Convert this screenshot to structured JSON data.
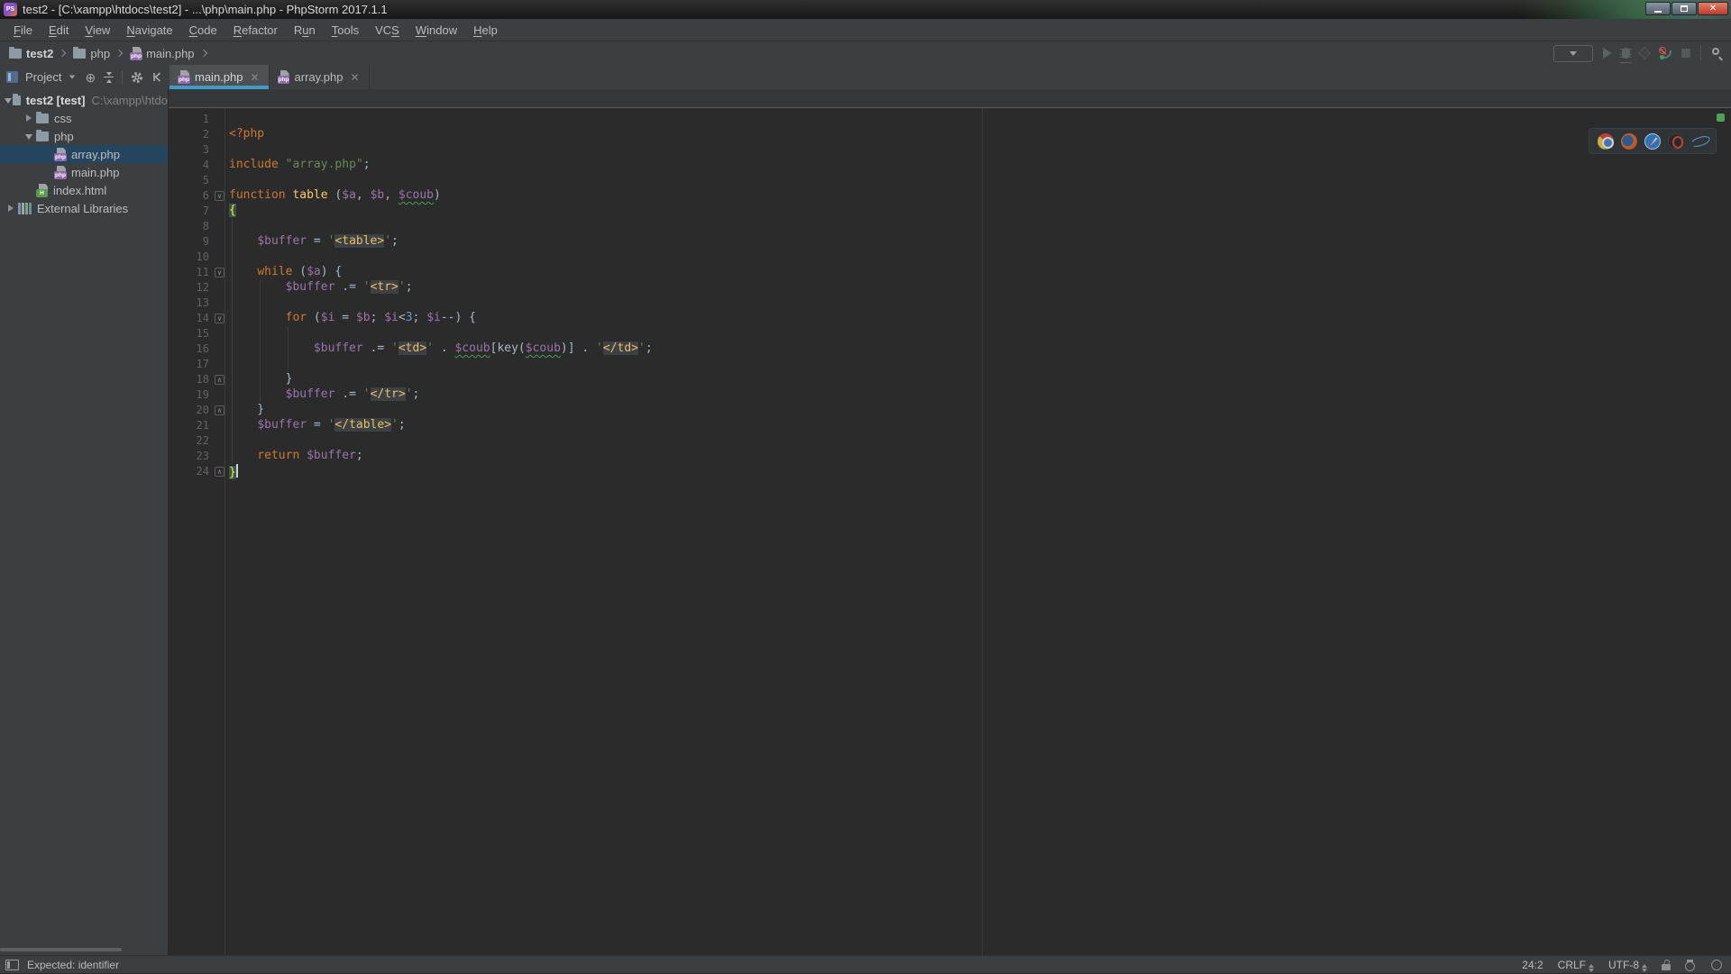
{
  "window": {
    "title": "test2 - [C:\\xampp\\htdocs\\test2] - ...\\php\\main.php - PhpStorm 2017.1.1",
    "app_badge": "PS"
  },
  "menu": {
    "items": [
      {
        "label": "File",
        "mnemonic": 0
      },
      {
        "label": "Edit",
        "mnemonic": 0
      },
      {
        "label": "View",
        "mnemonic": 0
      },
      {
        "label": "Navigate",
        "mnemonic": 0
      },
      {
        "label": "Code",
        "mnemonic": 0
      },
      {
        "label": "Refactor",
        "mnemonic": 0
      },
      {
        "label": "Run",
        "mnemonic": 1
      },
      {
        "label": "Tools",
        "mnemonic": 0
      },
      {
        "label": "VCS",
        "mnemonic": 2
      },
      {
        "label": "Window",
        "mnemonic": 0
      },
      {
        "label": "Help",
        "mnemonic": 0
      }
    ]
  },
  "breadcrumbs": {
    "items": [
      {
        "label": "test2",
        "icon": "folder",
        "bold": true
      },
      {
        "label": "php",
        "icon": "folder",
        "bold": false
      },
      {
        "label": "main.php",
        "icon": "php-file",
        "bold": false
      }
    ]
  },
  "project_panel": {
    "header_label": "Project",
    "tree": [
      {
        "label": "test2 [test]",
        "hint": "C:\\xampp\\htdo",
        "icon": "folder",
        "depth": 0,
        "arrow": "expanded",
        "bold": true,
        "selected": false
      },
      {
        "label": "css",
        "icon": "folder",
        "depth": 1,
        "arrow": "collapsed",
        "bold": false,
        "selected": false
      },
      {
        "label": "php",
        "icon": "folder",
        "depth": 1,
        "arrow": "expanded",
        "bold": false,
        "selected": false
      },
      {
        "label": "array.php",
        "icon": "php-file",
        "depth": 2,
        "arrow": null,
        "bold": false,
        "selected": true
      },
      {
        "label": "main.php",
        "icon": "php-file",
        "depth": 2,
        "arrow": null,
        "bold": false,
        "selected": false
      },
      {
        "label": "index.html",
        "icon": "html-file",
        "depth": 1,
        "arrow": null,
        "bold": false,
        "selected": false
      },
      {
        "label": "External Libraries",
        "icon": "libraries",
        "depth": 0,
        "arrow": "collapsed",
        "bold": false,
        "selected": false
      }
    ]
  },
  "tabs": [
    {
      "label": "main.php",
      "icon": "php-file",
      "active": true
    },
    {
      "label": "array.php",
      "icon": "php-file",
      "active": false
    }
  ],
  "browser_bar": {
    "browsers": [
      "chrome",
      "firefox",
      "safari",
      "opera",
      "ie"
    ]
  },
  "editor": {
    "caret_line": 24,
    "colors": {
      "keyword": "#cc7832",
      "variable": "#9876aa",
      "string": "#6a8759",
      "html_tag": "#e8bf6a",
      "number": "#6897bb",
      "function": "#ffc66d",
      "brace_match_bg": "#3b514d",
      "tab_underline": "#3f9cc7"
    },
    "lines": [
      {
        "n": 1,
        "tokens": []
      },
      {
        "n": 2,
        "tokens": [
          [
            "k",
            "<?php"
          ]
        ]
      },
      {
        "n": 3,
        "tokens": []
      },
      {
        "n": 4,
        "tokens": [
          [
            "k",
            "include"
          ],
          [
            "p",
            " "
          ],
          [
            "s",
            "\"array.php\""
          ],
          [
            "p",
            ";"
          ]
        ]
      },
      {
        "n": 5,
        "tokens": []
      },
      {
        "n": 6,
        "fold": "start",
        "tokens": [
          [
            "k",
            "function"
          ],
          [
            "p",
            " "
          ],
          [
            "f",
            "table"
          ],
          [
            "p",
            " ("
          ],
          [
            "v",
            "$a"
          ],
          [
            "p",
            ", "
          ],
          [
            "v",
            "$b"
          ],
          [
            "p",
            ", "
          ],
          [
            "w",
            "$coub"
          ],
          [
            "p",
            ")"
          ]
        ]
      },
      {
        "n": 7,
        "tokens": [
          [
            "b",
            "{"
          ]
        ]
      },
      {
        "n": 8,
        "tokens": []
      },
      {
        "n": 9,
        "tokens": [
          [
            "p",
            "    "
          ],
          [
            "v",
            "$buffer"
          ],
          [
            "p",
            " = "
          ],
          [
            "s",
            "'"
          ],
          [
            "t",
            "<table>"
          ],
          [
            "s",
            "'"
          ],
          [
            "p",
            ";"
          ]
        ]
      },
      {
        "n": 10,
        "tokens": []
      },
      {
        "n": 11,
        "fold": "start",
        "tokens": [
          [
            "p",
            "    "
          ],
          [
            "k",
            "while"
          ],
          [
            "p",
            " ("
          ],
          [
            "v",
            "$a"
          ],
          [
            "p",
            ") {"
          ]
        ]
      },
      {
        "n": 12,
        "tokens": [
          [
            "p",
            "        "
          ],
          [
            "v",
            "$buffer"
          ],
          [
            "p",
            " .= "
          ],
          [
            "s",
            "'"
          ],
          [
            "t",
            "<tr>"
          ],
          [
            "s",
            "'"
          ],
          [
            "p",
            ";"
          ]
        ]
      },
      {
        "n": 13,
        "tokens": []
      },
      {
        "n": 14,
        "fold": "start",
        "tokens": [
          [
            "p",
            "        "
          ],
          [
            "k",
            "for"
          ],
          [
            "p",
            " ("
          ],
          [
            "v",
            "$i"
          ],
          [
            "p",
            " = "
          ],
          [
            "v",
            "$b"
          ],
          [
            "p",
            "; "
          ],
          [
            "v",
            "$i"
          ],
          [
            "p",
            "<"
          ],
          [
            "n2",
            "3"
          ],
          [
            "p",
            "; "
          ],
          [
            "v",
            "$i"
          ],
          [
            "p",
            "--) {"
          ]
        ]
      },
      {
        "n": 15,
        "tokens": []
      },
      {
        "n": 16,
        "tokens": [
          [
            "p",
            "            "
          ],
          [
            "v",
            "$buffer"
          ],
          [
            "p",
            " .= "
          ],
          [
            "s",
            "'"
          ],
          [
            "t",
            "<td>"
          ],
          [
            "s",
            "'"
          ],
          [
            "p",
            " . "
          ],
          [
            "w",
            "$coub"
          ],
          [
            "p",
            "[key("
          ],
          [
            "w",
            "$coub"
          ],
          [
            "p",
            ")] . "
          ],
          [
            "s",
            "'"
          ],
          [
            "t",
            "</td>"
          ],
          [
            "s",
            "'"
          ],
          [
            "p",
            ";"
          ]
        ]
      },
      {
        "n": 17,
        "tokens": []
      },
      {
        "n": 18,
        "fold": "end",
        "tokens": [
          [
            "p",
            "        }"
          ]
        ]
      },
      {
        "n": 19,
        "tokens": [
          [
            "p",
            "        "
          ],
          [
            "v",
            "$buffer"
          ],
          [
            "p",
            " .= "
          ],
          [
            "s",
            "'"
          ],
          [
            "t",
            "</tr>"
          ],
          [
            "s",
            "'"
          ],
          [
            "p",
            ";"
          ]
        ]
      },
      {
        "n": 20,
        "fold": "end",
        "tokens": [
          [
            "p",
            "    }"
          ]
        ]
      },
      {
        "n": 21,
        "tokens": [
          [
            "p",
            "    "
          ],
          [
            "v",
            "$buffer"
          ],
          [
            "p",
            " = "
          ],
          [
            "s",
            "'"
          ],
          [
            "t",
            "</table>"
          ],
          [
            "s",
            "'"
          ],
          [
            "p",
            ";"
          ]
        ]
      },
      {
        "n": 22,
        "tokens": []
      },
      {
        "n": 23,
        "tokens": [
          [
            "p",
            "    "
          ],
          [
            "k",
            "return"
          ],
          [
            "p",
            " "
          ],
          [
            "v",
            "$buffer"
          ],
          [
            "p",
            ";"
          ]
        ]
      },
      {
        "n": 24,
        "fold": "end",
        "tokens": [
          [
            "b",
            "}"
          ]
        ]
      }
    ]
  },
  "status_bar": {
    "message": "Expected: identifier",
    "position": "24:2",
    "line_separator": "CRLF",
    "encoding": "UTF-8"
  }
}
